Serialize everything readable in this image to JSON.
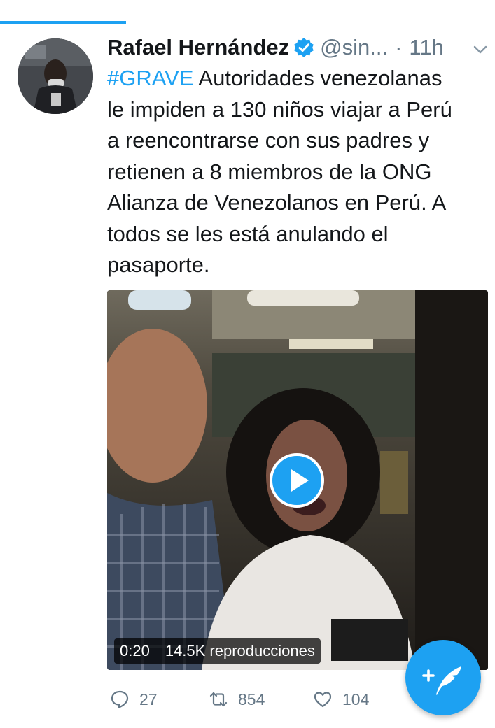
{
  "tweet": {
    "author": {
      "name": "Rafael Hernández",
      "handle": "@sin...",
      "verified": true,
      "time_separator": "·",
      "time": "11h"
    },
    "text": {
      "hashtag": "#GRAVE",
      "line1_rest": " Autoridades venezolanas",
      "line2": "le impiden a 130 niños viajar a Perú",
      "line3": "a reencontrarse con sus padres y",
      "line4": "retienen a 8 miembros de la ONG",
      "line5": "Alianza de Venezolanos en Perú. A",
      "line6": "todos se les está anulando el",
      "line7": "pasaporte."
    },
    "video": {
      "duration": "0:20",
      "views": "14.5K reproducciones"
    },
    "actions": {
      "replies": "27",
      "retweets": "854",
      "likes": "104"
    }
  },
  "colors": {
    "accent": "#1da1f2",
    "text_primary": "#14171a",
    "text_secondary": "#657786"
  },
  "icons": {
    "verified": "verified-badge-icon",
    "caret": "chevron-down-icon",
    "play": "play-icon",
    "reply": "reply-icon",
    "retweet": "retweet-icon",
    "like": "heart-icon",
    "compose": "compose-tweet-icon"
  }
}
